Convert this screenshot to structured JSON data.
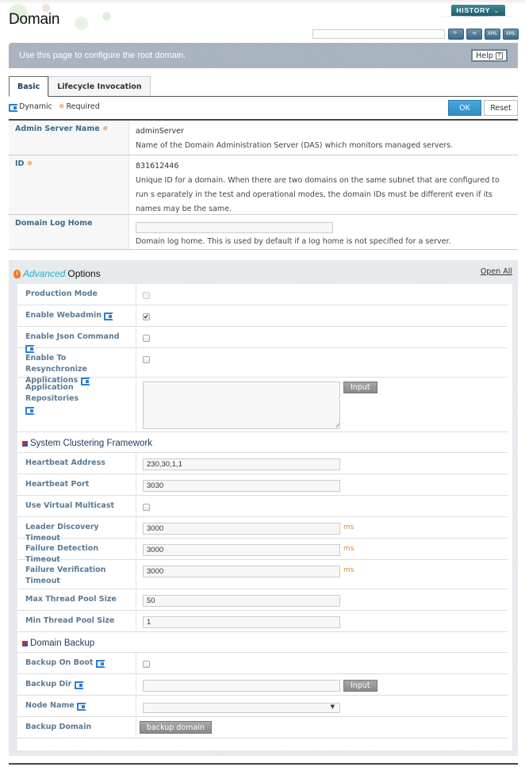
{
  "header": {
    "title": "Domain",
    "history_label": "HISTORY",
    "search_placeholder": "",
    "tool_icons": [
      "search-icon",
      "refresh-icon",
      "xml-export-icon",
      "xml-import-icon"
    ],
    "banner_text": "Use this page to configure the root domain.",
    "help_label": "Help",
    "help_icon_glyph": "?"
  },
  "tabs": [
    {
      "label": "Basic",
      "active": true
    },
    {
      "label": "Lifecycle Invocation",
      "active": false
    }
  ],
  "legend": {
    "dynamic_label": "Dynamic",
    "required_label": "Required"
  },
  "actions": {
    "ok_label": "OK",
    "reset_label": "Reset"
  },
  "basic": {
    "admin_server_name": {
      "label": "Admin Server Name",
      "value": "adminServer",
      "description": "Name of the Domain Administration Server (DAS) which monitors managed servers."
    },
    "id": {
      "label": "ID",
      "value": "831612446",
      "description": "Unique ID for a domain. When there are two domains on the same subnet that are configured to run s eparately in the test and operational modes, the domain IDs must be different even if its names may be the same."
    },
    "domain_log_home": {
      "label": "Domain Log Home",
      "value": "",
      "description": "Domain log home. This is used by default if a log home is not specified for a server."
    }
  },
  "advanced": {
    "title_em": "Advanced",
    "title_rest": "Options",
    "open_all_label": "Open All",
    "production_mode": {
      "label": "Production Mode",
      "checked": false,
      "disabled": true
    },
    "enable_webadmin": {
      "label": "Enable Webadmin",
      "checked": true
    },
    "enable_json_command": {
      "label": "Enable Json Command",
      "checked": false
    },
    "enable_resync": {
      "label": "Enable To Resynchronize Applications",
      "checked": false
    },
    "app_repositories": {
      "label": "Application Repositories",
      "value": "",
      "button_label": "Input"
    },
    "clustering": {
      "title": "System Clustering Framework",
      "heartbeat_address": {
        "label": "Heartbeat Address",
        "value": "230,30,1,1"
      },
      "heartbeat_port": {
        "label": "Heartbeat Port",
        "value": "3030"
      },
      "use_virtual_multicast": {
        "label": "Use Virtual Multicast",
        "checked": false
      },
      "leader_discovery_timeout": {
        "label": "Leader Discovery Timeout",
        "value": "3000",
        "unit": "ms"
      },
      "failure_detection_timeout": {
        "label": "Failure Detection Timeout",
        "value": "3000",
        "unit": "ms"
      },
      "failure_verification_timeout": {
        "label": "Failure Verification Timeout",
        "value": "3000",
        "unit": "ms"
      },
      "max_thread_pool_size": {
        "label": "Max Thread Pool Size",
        "value": "50"
      },
      "min_thread_pool_size": {
        "label": "Min Thread Pool Size",
        "value": "1"
      }
    },
    "backup": {
      "title": "Domain Backup",
      "backup_on_boot": {
        "label": "Backup On Boot",
        "checked": false
      },
      "backup_dir": {
        "label": "Backup Dir",
        "value": "",
        "button_label": "Input"
      },
      "node_name": {
        "label": "Node Name",
        "selected": ""
      },
      "backup_domain": {
        "label": "Backup Domain",
        "button_label": "backup domain"
      }
    }
  },
  "colors": {
    "accent_blue": "#2e8dc8",
    "label_blue": "#3a6a8f",
    "required_orange": "#f08a24",
    "advanced_teal": "#22b2c6",
    "banner_gray": "#a6b2bd",
    "history_teal": "#1f5e6c"
  }
}
